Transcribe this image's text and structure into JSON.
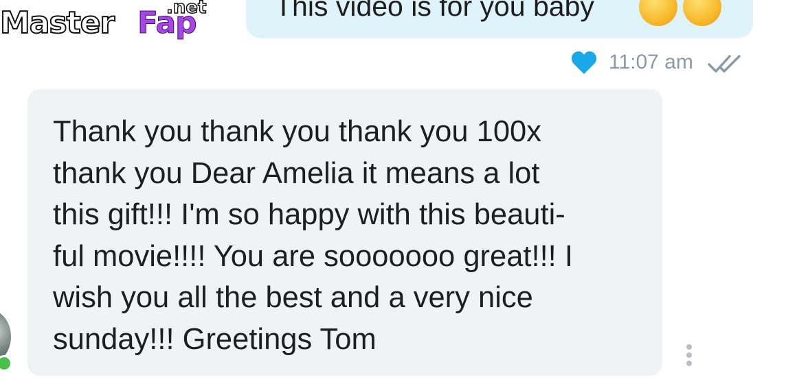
{
  "watermark": {
    "master": "Master",
    "fap": "Fap",
    "net": ".net"
  },
  "sent_message": {
    "text": "This video is for you baby",
    "emojis": [
      "tongue-out-face",
      "grinning-face"
    ]
  },
  "sent_meta": {
    "time": "11:07 am",
    "liked": true,
    "read_status": "double-tick",
    "heart_color": "#1aa9e8"
  },
  "received_message": {
    "text": "Thank you thank you thank you 100x\nthank you Dear Amelia it means a lot\nthis gift!!! I'm so happy with this beauti-\nful movie!!!! You are sooooooo great!!! I\nwish you all the best and a very nice\nsunday!!! Greetings Tom"
  },
  "sender": {
    "online": true,
    "status_color": "#49c04a"
  },
  "colors": {
    "sent_bubble": "#dff3fa",
    "received_bubble": "#f1f2f3",
    "meta_text": "#8e9aa3"
  }
}
